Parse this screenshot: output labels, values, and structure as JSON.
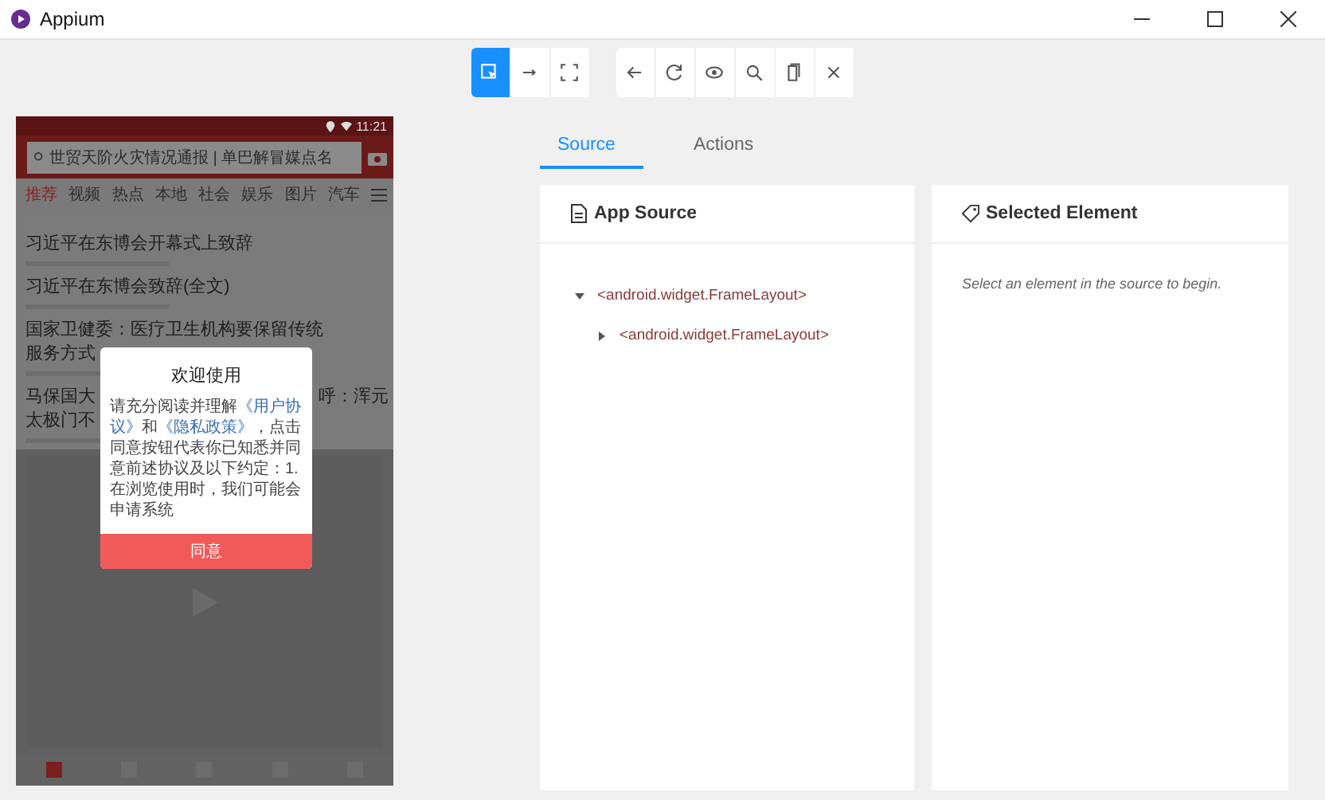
{
  "window": {
    "title": "Appium"
  },
  "toolbar": {
    "groups": [
      [
        {
          "kind": "select",
          "selected": true
        },
        {
          "kind": "swipe",
          "selected": false
        },
        {
          "kind": "tap",
          "selected": false
        }
      ],
      [
        {
          "kind": "back",
          "selected": false
        },
        {
          "kind": "refresh",
          "selected": false
        },
        {
          "kind": "eye",
          "selected": false
        },
        {
          "kind": "search",
          "selected": false
        },
        {
          "kind": "copy",
          "selected": false
        },
        {
          "kind": "close",
          "selected": false
        }
      ]
    ]
  },
  "device": {
    "status_time": "11:21",
    "search_text": "世贸天阶火灾情况通报 | 单巴解冒媒点名",
    "channels": [
      {
        "label": "推荐",
        "selected": true
      },
      {
        "label": "视频",
        "selected": false
      },
      {
        "label": "热点",
        "selected": false
      },
      {
        "label": "本地",
        "selected": false
      },
      {
        "label": "社会",
        "selected": false
      },
      {
        "label": "娱乐",
        "selected": false
      },
      {
        "label": "图片",
        "selected": false
      },
      {
        "label": "汽车",
        "selected": false
      }
    ],
    "headlines": [
      {
        "lines": [
          [
            "习近平在东博会开幕式上致辞"
          ]
        ]
      },
      {
        "lines": [
          [
            "习近平在东博会致辞(全文)"
          ]
        ]
      },
      {
        "lines": [
          [
            "国家卫健委：医疗卫生机构要保留传统"
          ],
          [
            "服务方式"
          ]
        ]
      },
      {
        "lines": [
          [
            "马保国大",
            "呼：浑元"
          ],
          [
            "太极门不"
          ]
        ]
      }
    ],
    "dialog": {
      "title": "欢迎使用",
      "body": "请充分阅读并理解**《用户协议》**和**《隐私政策》**，点击同意按钮代表你已知悉并同意前述协议及以下约定：1. 在浏览使用时，我们可能会申请系统",
      "button": "同意"
    }
  },
  "tabs": [
    {
      "label": "Source",
      "selected": true
    },
    {
      "label": "Actions",
      "selected": false
    }
  ],
  "source_panel": {
    "title": "App Source",
    "tree": [
      {
        "label": "<android.widget.FrameLayout>",
        "expanded": true,
        "children": [
          {
            "label": "<android.widget.FrameLayout>",
            "expanded": false
          }
        ]
      }
    ]
  },
  "selected_panel": {
    "title": "Selected Element",
    "hint": "Select an element in the source to begin."
  }
}
